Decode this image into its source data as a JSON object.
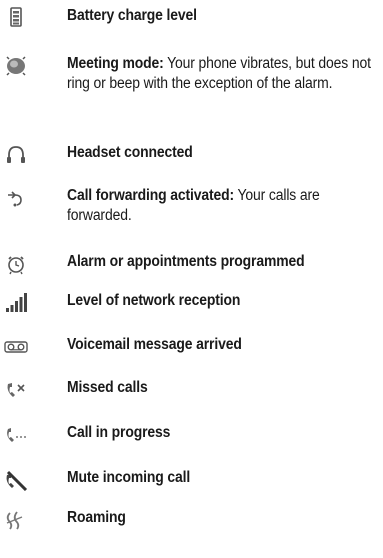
{
  "items": [
    {
      "icon": "battery-icon",
      "term": "Battery charge level",
      "desc": ""
    },
    {
      "icon": "meeting-mode-icon",
      "term": "Meeting mode:",
      "desc": " Your phone vibrates, but does not ring or beep with the exception of the alarm."
    },
    {
      "icon": "headset-icon",
      "term": "Headset connected",
      "desc": ""
    },
    {
      "icon": "call-forwarding-icon",
      "term": "Call forwarding activated:",
      "desc": " Your calls are forwarded."
    },
    {
      "icon": "alarm-clock-icon",
      "term": "Alarm or appointments programmed",
      "desc": ""
    },
    {
      "icon": "signal-strength-icon",
      "term": "Level of network reception",
      "desc": ""
    },
    {
      "icon": "voicemail-icon",
      "term": "Voicemail message arrived",
      "desc": ""
    },
    {
      "icon": "missed-calls-icon",
      "term": "Missed calls",
      "desc": ""
    },
    {
      "icon": "call-in-progress-icon",
      "term": "Call in progress",
      "desc": ""
    },
    {
      "icon": "mute-icon",
      "term": "Mute incoming call",
      "desc": ""
    },
    {
      "icon": "roaming-icon",
      "term": "Roaming",
      "desc": ""
    }
  ]
}
